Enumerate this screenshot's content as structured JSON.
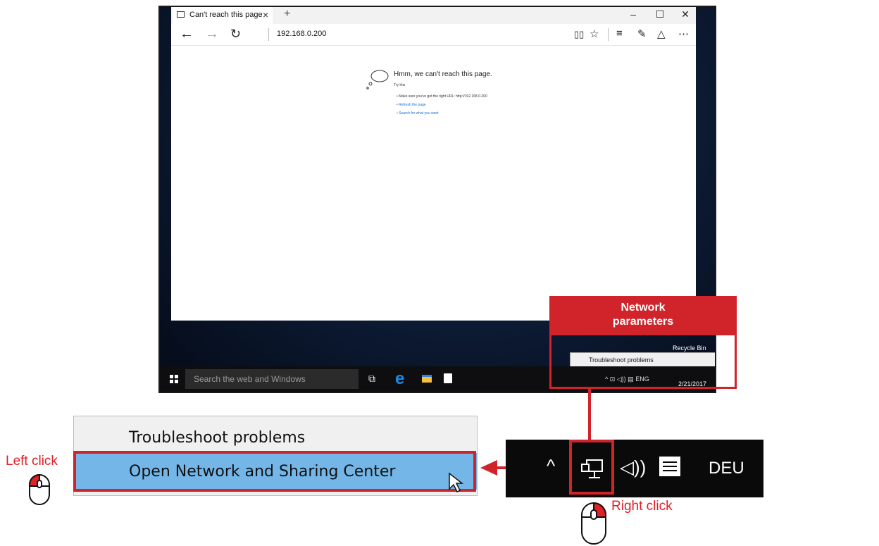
{
  "browser": {
    "tab_title": "Can't reach this page",
    "url": "192.168.0.200",
    "window_controls": {
      "minimize": "–",
      "maximize": "☐",
      "close": "✕"
    },
    "nav": {
      "back": "←",
      "forward": "→",
      "refresh": "↻"
    },
    "toolbar_icons": [
      "reading-view-icon",
      "favorites-star-icon",
      "hub-icon",
      "web-note-icon",
      "share-icon",
      "more-icon"
    ]
  },
  "error_page": {
    "title": "Hmm, we can't reach this page.",
    "try_this": "Try this",
    "suggestions": [
      "Make sure you've got the right URL: http://192.168.0.200",
      "Refresh the page",
      "Search for what you want"
    ]
  },
  "desktop": {
    "recycle_bin_label": "Recycle Bin"
  },
  "taskbar": {
    "search_placeholder": "Search the web and Windows",
    "date": "2/21/2017",
    "tray_text": "ENG"
  },
  "context_menu": {
    "items": [
      "Troubleshoot problems",
      "Open Network and Sharing Center"
    ],
    "selected_index": 1
  },
  "callout": {
    "title_line1": "Network",
    "title_line2": "parameters"
  },
  "zoom_tray": {
    "language": "DEU"
  },
  "instructions": {
    "left_click": "Left click",
    "right_click": "Right click"
  },
  "colors": {
    "accent_red": "#d0232a",
    "menu_highlight": "#74b6e7",
    "taskbar": "#0e0e10",
    "edge_blue": "#1c8ae6"
  }
}
